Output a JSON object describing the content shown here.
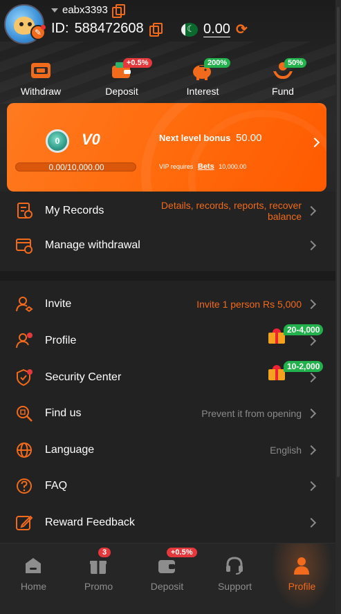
{
  "header": {
    "username": "eabx3393",
    "id_label": "ID:",
    "id_value": "588472608",
    "balance": "0.00",
    "icons": [
      "avatar",
      "edit-icon",
      "copy-icon",
      "pakistan-flag-icon",
      "refresh-icon"
    ]
  },
  "quick_actions": [
    {
      "label": "Withdraw",
      "icon": "withdraw-icon",
      "tag": ""
    },
    {
      "label": "Deposit",
      "icon": "wallet-icon",
      "tag": "+0.5%"
    },
    {
      "label": "Interest",
      "icon": "piggy-bank-icon",
      "tag": "200%"
    },
    {
      "label": "Fund",
      "icon": "fund-hands-icon",
      "tag": "50%"
    }
  ],
  "vip": {
    "medal_level": "0",
    "level": "V0",
    "progress_text": "0.00/10,000.00",
    "progress_fraction": 0,
    "next_bonus_label": "Next level bonus",
    "next_bonus_amount": "50.00",
    "requires_label": "VIP requires",
    "bets_label": "Bets",
    "requires_amount": "10,000.00"
  },
  "menu": {
    "records": {
      "label": "My Records",
      "value": "Details, records, reports, recover balance"
    },
    "manage_withdrawal": {
      "label": "Manage withdrawal"
    },
    "invite": {
      "label": "Invite",
      "value": "Invite 1 person Rs 5,000"
    },
    "profile": {
      "label": "Profile",
      "gift_tag": "20-4,000"
    },
    "security": {
      "label": "Security Center",
      "gift_tag": "10-2,000"
    },
    "find_us": {
      "label": "Find us",
      "value": "Prevent it from opening"
    },
    "language": {
      "label": "Language",
      "value": "English"
    },
    "faq": {
      "label": "FAQ"
    },
    "feedback": {
      "label": "Reward Feedback"
    }
  },
  "nav": {
    "home": {
      "label": "Home"
    },
    "promo": {
      "label": "Promo",
      "badge": "3"
    },
    "deposit": {
      "label": "Deposit",
      "badge": "+0.5%"
    },
    "support": {
      "label": "Support"
    },
    "profile": {
      "label": "Profile"
    }
  },
  "colors": {
    "accent": "#f26a1b",
    "background": "#222222",
    "badge_red": "#e4393c",
    "badge_green": "#22b14c"
  }
}
